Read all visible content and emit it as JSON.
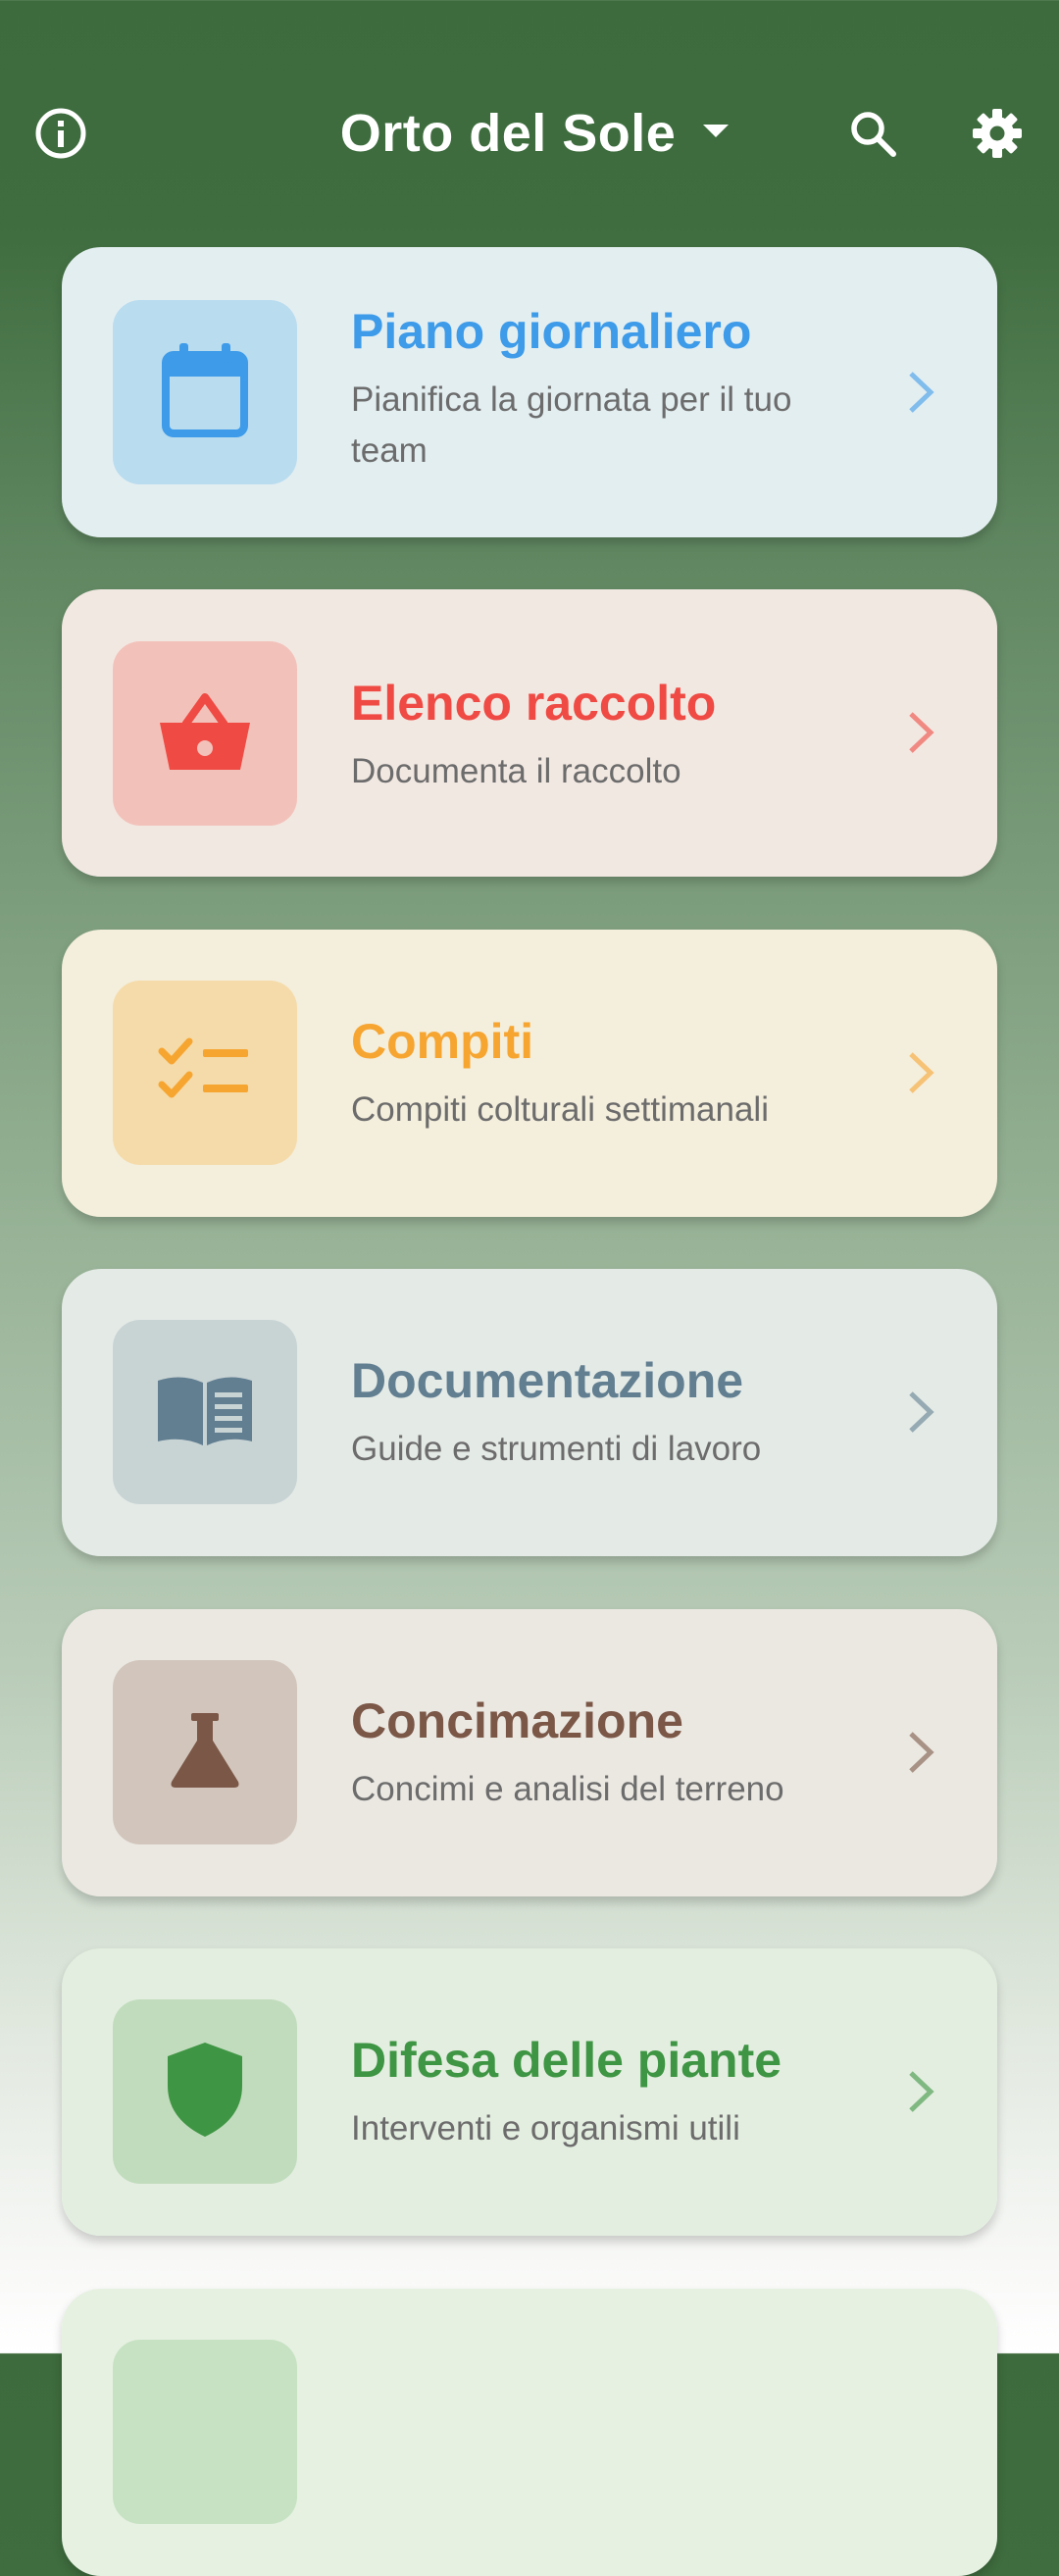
{
  "header": {
    "title": "Orto del Sole",
    "info_icon": "info-circle-icon",
    "dropdown_icon": "caret-down-icon",
    "search_icon": "search-icon",
    "settings_icon": "gear-icon"
  },
  "cards": [
    {
      "title": "Piano giornaliero",
      "subtitle": "Pianifica la giornata per il tuo team",
      "icon": "calendar-icon",
      "accent": "#3d9be9",
      "tile_bg": "#b9dcef",
      "card_bg": "#e3eef1"
    },
    {
      "title": "Elenco raccolto",
      "subtitle": "Documenta il raccolto",
      "icon": "basket-icon",
      "accent": "#ef4a43",
      "tile_bg": "#f2c2ba",
      "card_bg": "#f2e8e2"
    },
    {
      "title": "Compiti",
      "subtitle": "Compiti colturali settimanali",
      "icon": "checklist-icon",
      "accent": "#f6a531",
      "tile_bg": "#f5dba9",
      "card_bg": "#f4eedc"
    },
    {
      "title": "Documentazione",
      "subtitle": "Guide e strumenti di lavoro",
      "icon": "book-icon",
      "accent": "#627f91",
      "tile_bg": "#c8d3d4",
      "card_bg": "#e4eae6"
    },
    {
      "title": "Concimazione",
      "subtitle": "Concimi e analisi del terreno",
      "icon": "flask-icon",
      "accent": "#7b5747",
      "tile_bg": "#d2c6bc",
      "card_bg": "#ebe8e2"
    },
    {
      "title": "Difesa delle piante",
      "subtitle": "Interventi e organismi utili",
      "icon": "shield-icon",
      "accent": "#3e9543",
      "tile_bg": "#c1dcbd",
      "card_bg": "#e3eee0"
    },
    {
      "title": "",
      "subtitle": "",
      "icon": "",
      "accent": "#3e9543",
      "tile_bg": "#c7e2c3",
      "card_bg": "#e6f1e2"
    }
  ]
}
